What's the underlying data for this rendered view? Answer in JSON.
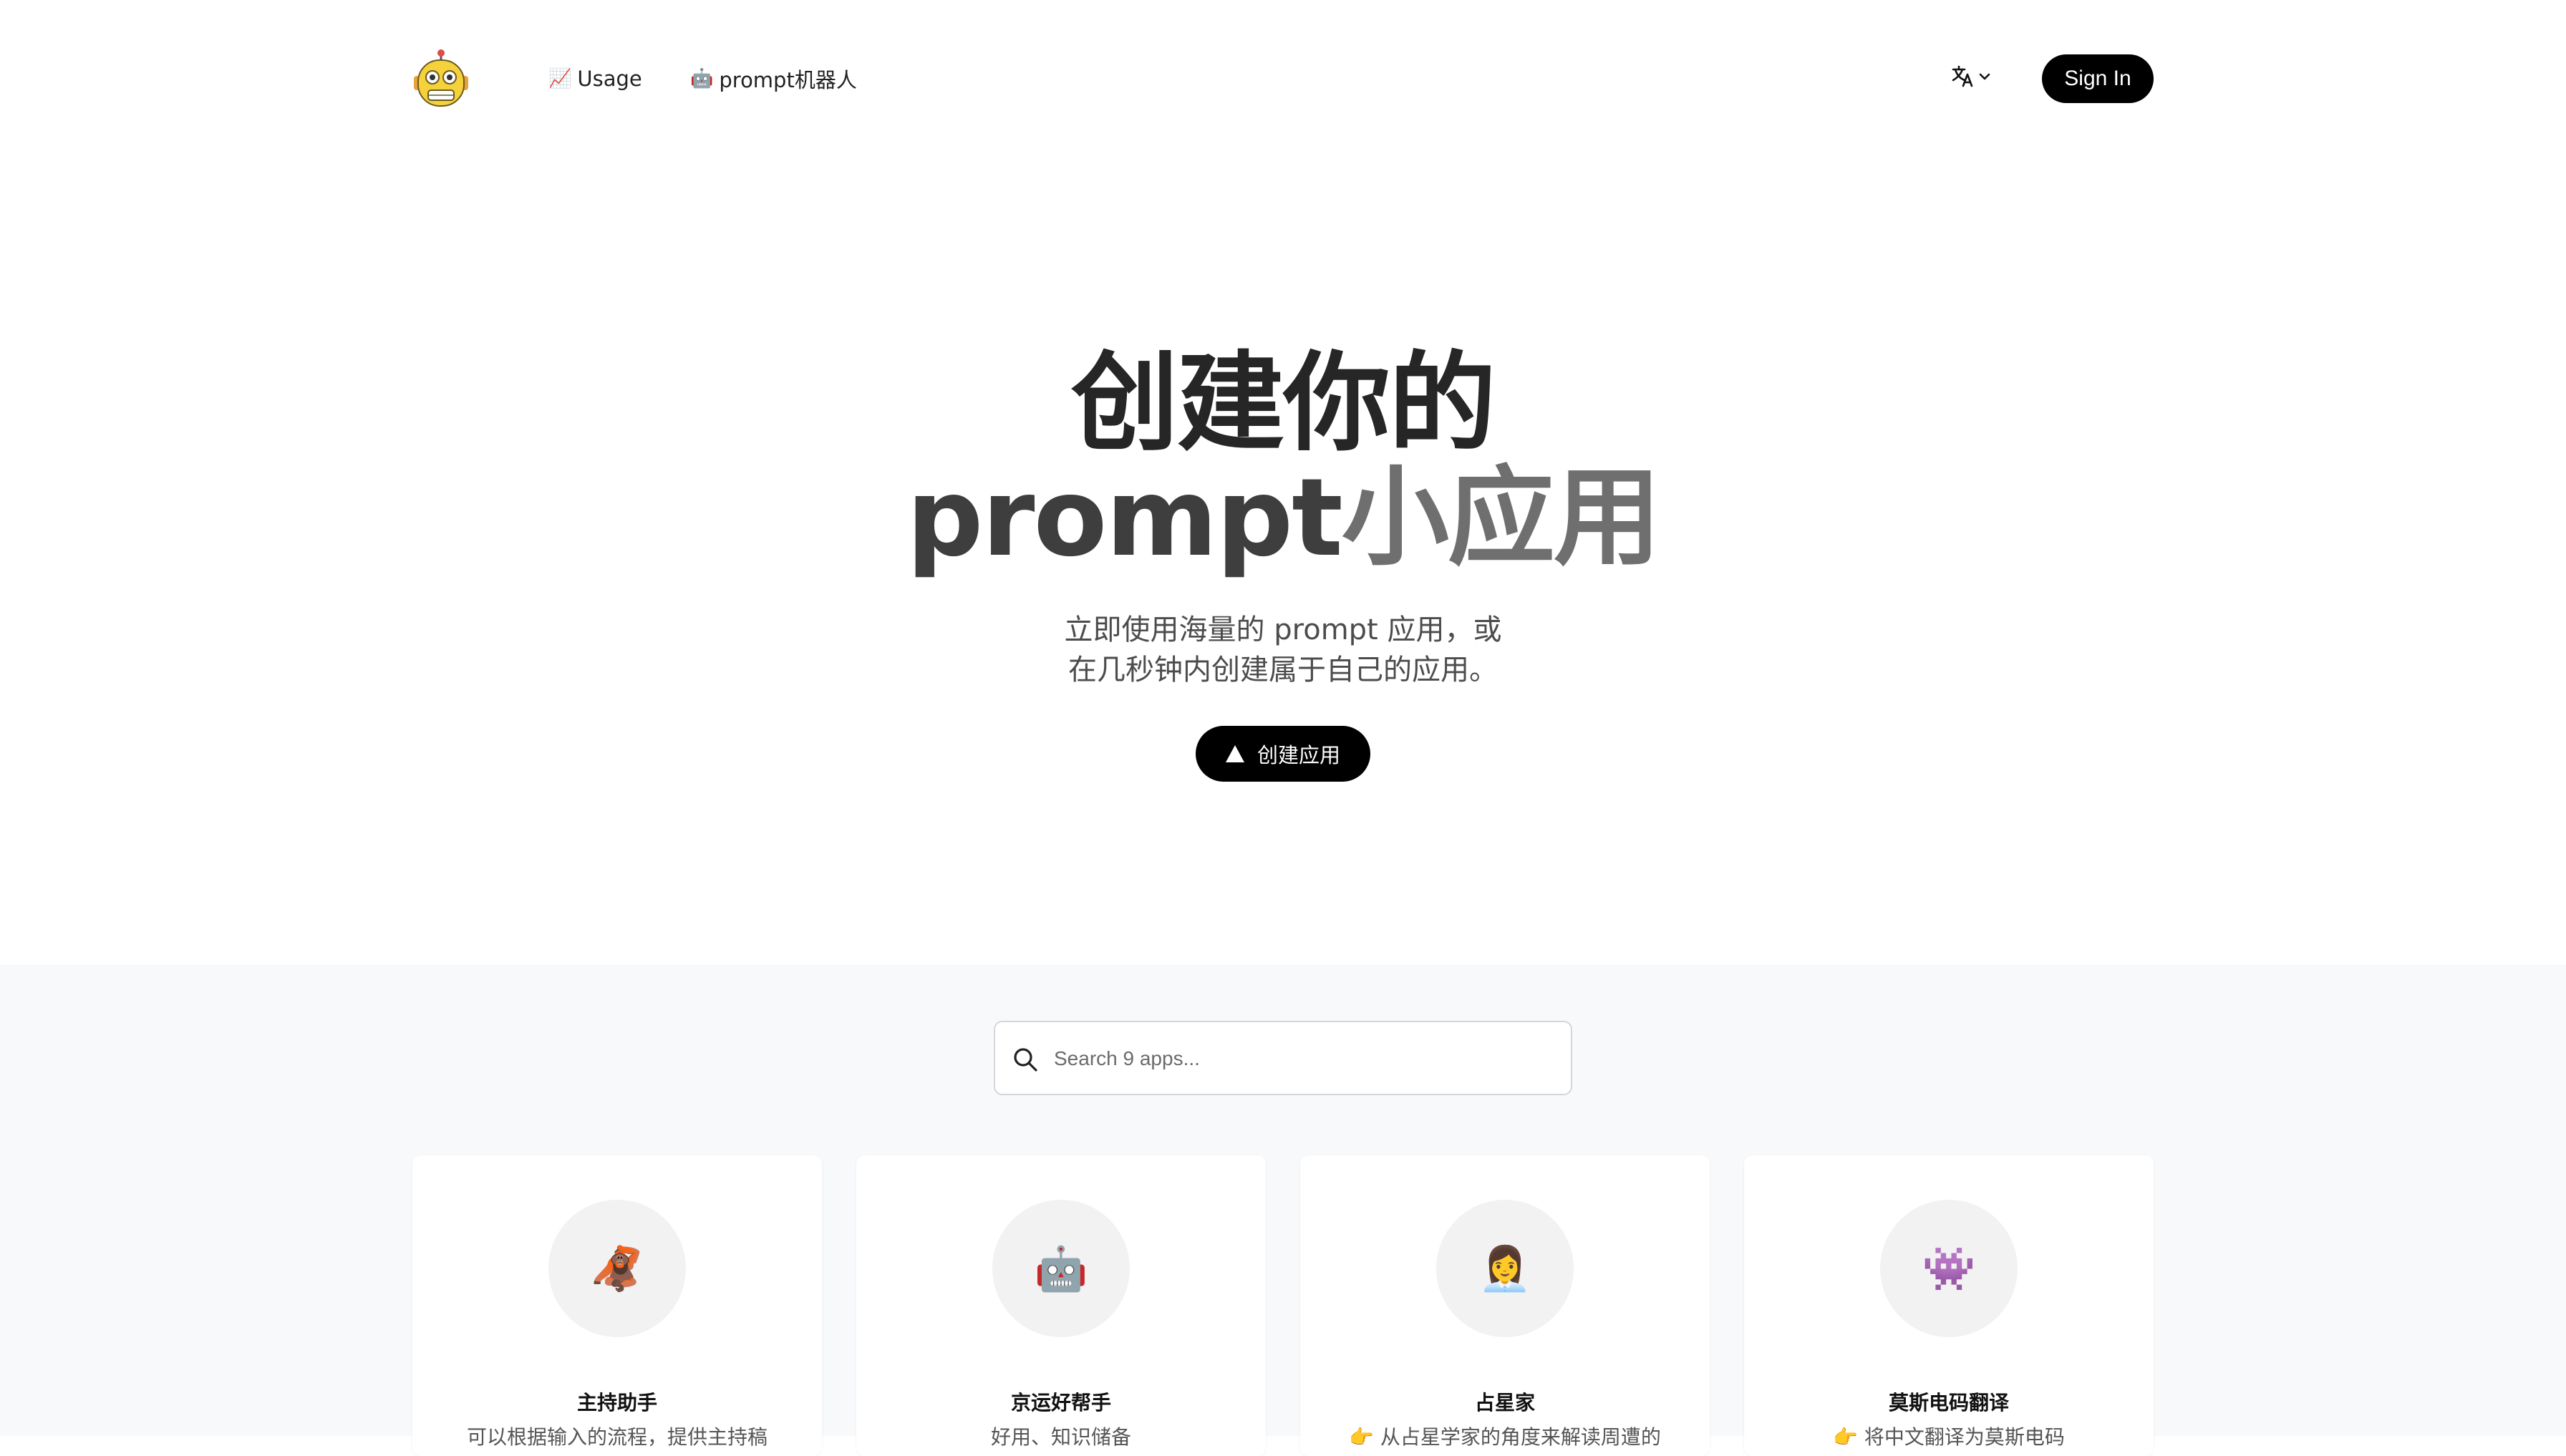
{
  "header": {
    "nav": [
      {
        "icon": "📈",
        "label": "Usage"
      },
      {
        "icon": "🤖",
        "label": "prompt机器人"
      }
    ],
    "sign_in_label": "Sign In"
  },
  "hero": {
    "title_line1": "创建你的",
    "title_line2_part1": "prompt",
    "title_line2_part2": "小应用",
    "subtitle_line1": "立即使用海量的 prompt 应用，或",
    "subtitle_line2": "在几秒钟内创建属于自己的应用。",
    "create_button_label": "创建应用"
  },
  "search": {
    "placeholder": "Search 9 apps..."
  },
  "apps": [
    {
      "icon": "🦧",
      "title": "主持助手",
      "description": "可以根据输入的流程，提供主持稿"
    },
    {
      "icon": "🤖",
      "title": "京运好帮手",
      "description": "好用、知识储备"
    },
    {
      "icon": "👩‍💼",
      "title": "占星家",
      "description": "👉 从占星学家的角度来解读周遭的"
    },
    {
      "icon": "👾",
      "title": "莫斯电码翻译",
      "description": "👉 将中文翻译为莫斯电码"
    }
  ],
  "colors": {
    "primary_button": "#000000",
    "section_background": "#f8f9fa"
  }
}
